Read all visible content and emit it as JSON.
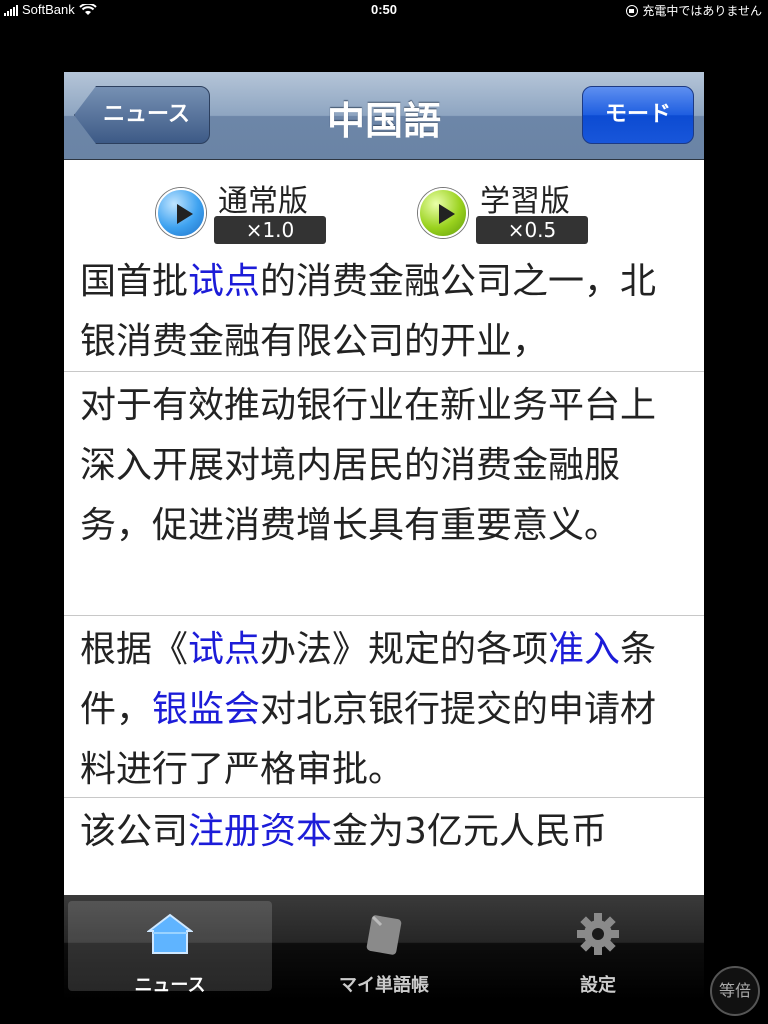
{
  "status_bar": {
    "carrier": "SoftBank",
    "time": "0:50",
    "charging_status": "充電中ではありません"
  },
  "navbar": {
    "back_label": "ニュース",
    "title": "中国語",
    "mode_label": "モード"
  },
  "players": {
    "normal": {
      "label": "通常版",
      "speed": "×1.0",
      "icon": "play-icon"
    },
    "study": {
      "label": "学習版",
      "speed": "×0.5",
      "icon": "play-icon"
    }
  },
  "text_blocks": [
    {
      "segments": [
        {
          "text": "国首批",
          "highlight": false
        },
        {
          "text": "试点",
          "highlight": true
        },
        {
          "text": "的消费金融公司之一，北银消费金融有限公司的开业，",
          "highlight": false
        }
      ]
    },
    {
      "segments": [
        {
          "text": "对于有效推动银行业在新业务平台上深入开展对境内居民的消费金融服务，促进消费增长具有重要意义。",
          "highlight": false
        }
      ]
    },
    {
      "segments": [
        {
          "text": "根据《",
          "highlight": false
        },
        {
          "text": "试点",
          "highlight": true
        },
        {
          "text": "办法》规定的各项",
          "highlight": false
        },
        {
          "text": "准入",
          "highlight": true
        },
        {
          "text": "条件，",
          "highlight": false
        },
        {
          "text": "银监会",
          "highlight": true
        },
        {
          "text": "对北京银行提交的申请材料进行了严格审批。",
          "highlight": false
        }
      ]
    },
    {
      "segments": [
        {
          "text": "该公司",
          "highlight": false
        },
        {
          "text": "注册资本",
          "highlight": true
        },
        {
          "text": "金为3亿元人民币",
          "highlight": false
        }
      ]
    }
  ],
  "colors": {
    "highlight": "#1c1cd8",
    "nav_blue": "#6a84a5",
    "mode_button": "#1856da"
  },
  "tabbar": {
    "tabs": [
      {
        "label": "ニュース",
        "icon": "home-icon",
        "selected": true
      },
      {
        "label": "マイ単語帳",
        "icon": "notebook-icon",
        "selected": false
      },
      {
        "label": "設定",
        "icon": "gear-icon",
        "selected": false
      }
    ]
  },
  "zoom_button": "等倍"
}
